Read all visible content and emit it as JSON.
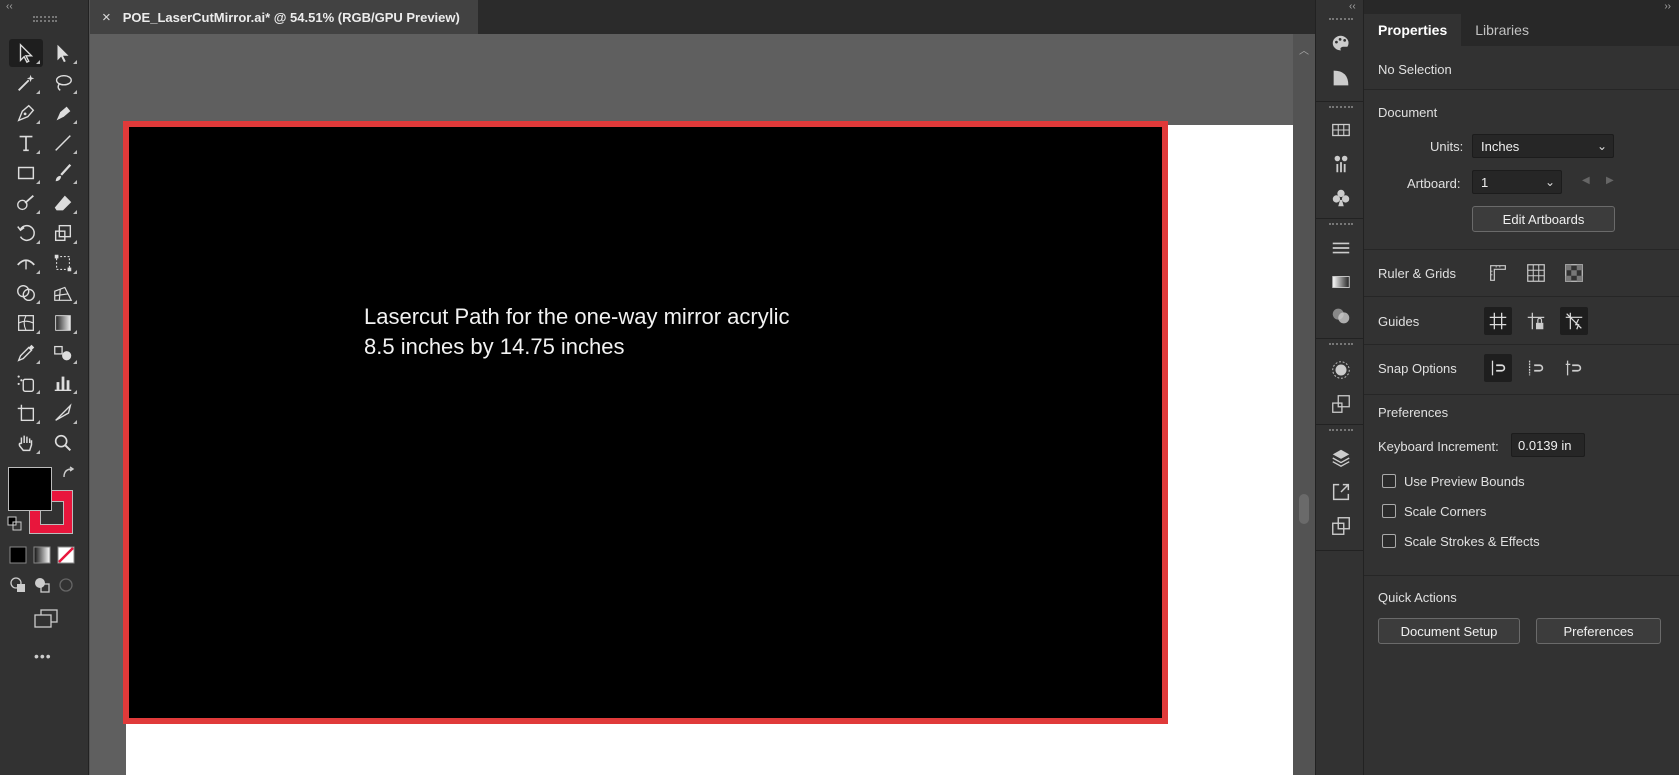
{
  "tab": {
    "close_icon": "×",
    "title": "POE_LaserCutMirror.ai* @ 54.51% (RGB/GPU Preview)"
  },
  "artwork": {
    "line1": "Lasercut Path for the one-way mirror acrylic",
    "line2": "8.5 inches by 14.75 inches",
    "fill_color": "#000000",
    "stroke_color": "#e03a3a"
  },
  "toolbar": {
    "fill_color": "#000000",
    "stroke_color": "#e8163c",
    "more": "•••"
  },
  "panel": {
    "tabs": [
      "Properties",
      "Libraries"
    ],
    "selection": "No Selection",
    "document": {
      "heading": "Document",
      "units_label": "Units:",
      "units_value": "Inches",
      "artboard_label": "Artboard:",
      "artboard_value": "1",
      "edit_artboards": "Edit Artboards"
    },
    "ruler_grids": "Ruler & Grids",
    "guides": "Guides",
    "snap_options": "Snap Options",
    "preferences": {
      "heading": "Preferences",
      "keyboard_increment_label": "Keyboard Increment:",
      "keyboard_increment_value": "0.0139 in",
      "use_preview_bounds": "Use Preview Bounds",
      "scale_corners": "Scale Corners",
      "scale_strokes_effects": "Scale Strokes & Effects"
    },
    "quick_actions": {
      "heading": "Quick Actions",
      "document_setup": "Document Setup",
      "preferences_button": "Preferences"
    }
  }
}
